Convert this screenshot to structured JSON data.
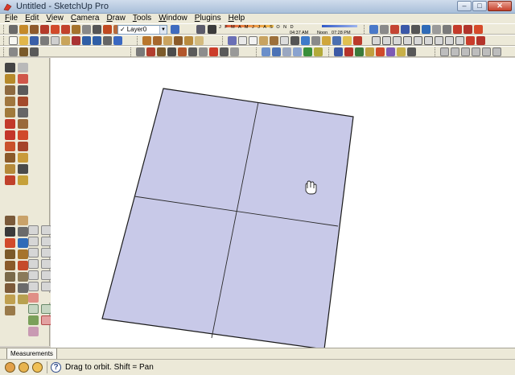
{
  "window": {
    "title": "Untitled - SketchUp Pro",
    "icon": "sketchup-logo-icon"
  },
  "window_buttons": {
    "minimize": "–",
    "maximize": "□",
    "close": "✕"
  },
  "menu": [
    {
      "label": "File",
      "accel": "F",
      "rest": "ile"
    },
    {
      "label": "Edit",
      "accel": "E",
      "rest": "dit"
    },
    {
      "label": "View",
      "accel": "V",
      "rest": "iew"
    },
    {
      "label": "Camera",
      "accel": "C",
      "rest": "amera"
    },
    {
      "label": "Draw",
      "accel": "D",
      "rest": "raw"
    },
    {
      "label": "Tools",
      "accel": "T",
      "rest": "ools"
    },
    {
      "label": "Window",
      "accel": "W",
      "rest": "indow"
    },
    {
      "label": "Plugins",
      "accel": "P",
      "rest": "lugins"
    },
    {
      "label": "Help",
      "accel": "H",
      "rest": "elp"
    }
  ],
  "layers": {
    "current": "Layer0"
  },
  "shadows": {
    "months": "J F M A M J J A S O N D",
    "time_start": "04:37 AM",
    "noon": "Noon",
    "time_end": "07:28 PM"
  },
  "canvas": {
    "background": "#ffffff",
    "face_color": "#c8c9e8",
    "edge_color": "#1a1a1a",
    "cursor": "pan-hand-icon"
  },
  "measurements": {
    "label": "Measurements"
  },
  "status": {
    "hint": "Drag to orbit.  Shift = Pan"
  },
  "colors": {
    "chrome": "#ece9d8",
    "titlebar": "#b9cbe2",
    "accent_blue": "#2f58c7",
    "accent_red": "#e05a3a"
  }
}
